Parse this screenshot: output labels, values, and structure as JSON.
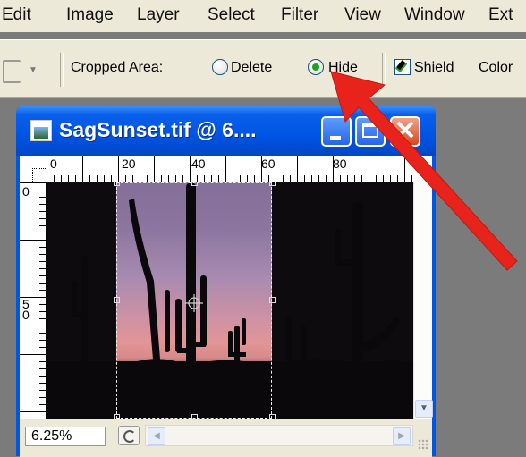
{
  "menu": [
    "Edit",
    "Image",
    "Layer",
    "Select",
    "Filter",
    "View",
    "Window",
    "Ext"
  ],
  "options_bar": {
    "cropped_area_label": "Cropped Area:",
    "delete_label": "Delete",
    "hide_label": "Hide",
    "hide_selected": true,
    "shield_label": "Shield",
    "shield_checked": true,
    "color_label": "Color"
  },
  "document_window": {
    "title": "SagSunset.tif @ 6....",
    "ruler_top_labels": [
      "0",
      "20",
      "40",
      "60",
      "80"
    ],
    "ruler_left_labels": [
      "0",
      "5",
      "0"
    ],
    "zoom": "6.25%"
  },
  "colors": {
    "titlebar": "#0054e3",
    "annotation_arrow": "#e8231c",
    "radio_selected": "#21a121"
  },
  "icons": {
    "crop_tool": "crop-tool-icon",
    "document": "document-icon",
    "minimize": "minimize-icon",
    "maximize": "maximize-icon",
    "close": "close-icon",
    "annotation": "red-arrow"
  }
}
